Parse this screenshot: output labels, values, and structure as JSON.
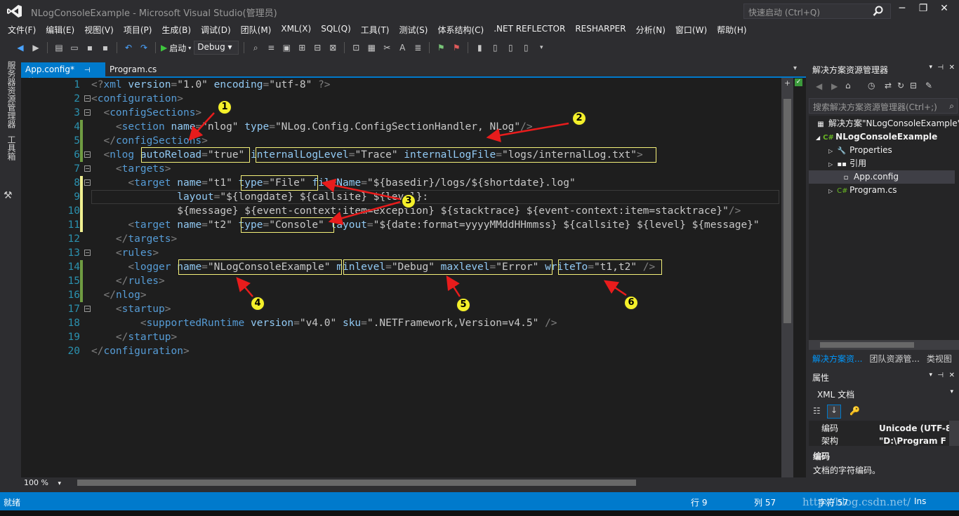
{
  "window": {
    "title": "NLogConsoleExample - Microsoft Visual Studio(管理员)",
    "quick_launch_placeholder": "快速启动 (Ctrl+Q)"
  },
  "menu": [
    "文件(F)",
    "编辑(E)",
    "视图(V)",
    "项目(P)",
    "生成(B)",
    "调试(D)",
    "团队(M)",
    "XML(X)",
    "SQL(Q)",
    "工具(T)",
    "测试(S)",
    "体系结构(C)",
    ".NET REFLECTOR",
    "RESHARPER",
    "分析(N)",
    "窗口(W)",
    "帮助(H)"
  ],
  "toolbar": {
    "start_label": "启动",
    "configuration": "Debug"
  },
  "left_strip": {
    "server_explorer": "服务器资源管理器",
    "toolbox": "工具箱"
  },
  "tabs": [
    {
      "label": "App.config*",
      "active": true
    },
    {
      "label": "Program.cs",
      "active": false
    }
  ],
  "editor": {
    "line_numbers": [
      "1",
      "2",
      "3",
      "4",
      "5",
      "6",
      "7",
      "8",
      "9",
      "10",
      "11",
      "12",
      "13",
      "14",
      "15",
      "16",
      "17",
      "18",
      "19",
      "20"
    ],
    "zoom": "100 %"
  },
  "annotations": [
    "1",
    "2",
    "3",
    "4",
    "5",
    "6"
  ],
  "solution_explorer": {
    "title": "解决方案资源管理器",
    "search_placeholder": "搜索解决方案资源管理器(Ctrl+;)",
    "items": [
      {
        "label": "解决方案\"NLogConsoleExample\"",
        "icon": "solution-icon"
      },
      {
        "label": "NLogConsoleExample",
        "icon": "csharp-project-icon"
      },
      {
        "label": "Properties",
        "icon": "wrench-icon"
      },
      {
        "label": "引用",
        "icon": "references-icon"
      },
      {
        "label": "App.config",
        "icon": "config-file-icon"
      },
      {
        "label": "Program.cs",
        "icon": "csharp-file-icon"
      }
    ],
    "bottom_tabs": [
      "解决方案资...",
      "团队资源管...",
      "类视图"
    ]
  },
  "properties": {
    "title": "属性",
    "object": "XML 文档",
    "rows": [
      {
        "name": "编码",
        "value": "Unicode (UTF-8"
      },
      {
        "name": "架构",
        "value": "\"D:\\Program F"
      }
    ],
    "desc_title": "编码",
    "desc_text": "文档的字符编码。"
  },
  "status": {
    "ready": "就绪",
    "line": "行 9",
    "col": "列 57",
    "char": "字符 57",
    "mode": "Ins",
    "watermark": "http://blog.csdn.net/"
  },
  "colors": {
    "accent": "#007acc",
    "highlight_box": "#f4f07a",
    "arrow": "#e81c1c"
  }
}
